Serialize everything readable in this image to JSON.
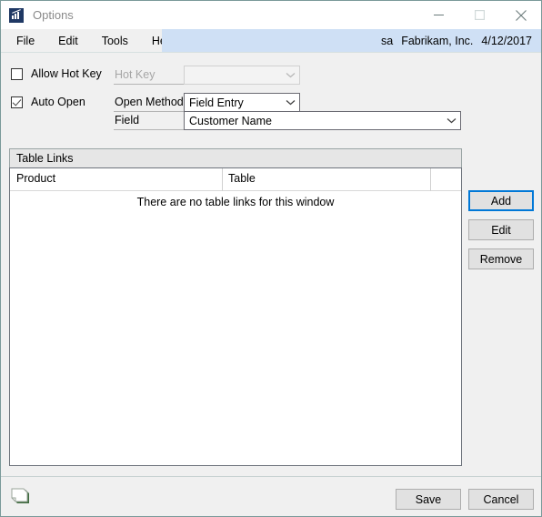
{
  "window": {
    "title": "Options",
    "app_icon": "chart-arrow-icon",
    "controls": {
      "minimize": "minimize-icon",
      "maximize": "maximize-icon",
      "close": "close-icon"
    }
  },
  "menubar": {
    "items": [
      {
        "label": "File"
      },
      {
        "label": "Edit"
      },
      {
        "label": "Tools"
      },
      {
        "label": "Help"
      }
    ],
    "status": {
      "user": "sa",
      "company": "Fabrikam, Inc.",
      "date": "4/12/2017",
      "background": "#cfe0f5"
    }
  },
  "form": {
    "allow_hot_key": {
      "label": "Allow Hot Key",
      "checked": false
    },
    "hot_key": {
      "label": "Hot Key",
      "value": "",
      "enabled": false
    },
    "auto_open": {
      "label": "Auto Open",
      "checked": true
    },
    "open_method": {
      "label": "Open Method",
      "value": "Field Entry",
      "enabled": true
    },
    "field": {
      "label": "Field",
      "value": "Customer Name",
      "enabled": true
    }
  },
  "table_links": {
    "panel_title": "Table Links",
    "columns": [
      "Product",
      "Table"
    ],
    "rows": [],
    "empty_message": "There are no table links for this window"
  },
  "side_buttons": [
    {
      "label": "Add",
      "focused": true
    },
    {
      "label": "Edit",
      "focused": false
    },
    {
      "label": "Remove",
      "focused": false
    }
  ],
  "bottom": {
    "note_icon": "note-icon",
    "save_label": "Save",
    "cancel_label": "Cancel"
  },
  "colors": {
    "window_background": "#f0f0f0",
    "list_background": "#ffffff",
    "panel_header": "#e6e6e6",
    "focus_accent": "#0078d7",
    "status_strip": "#cfe0f5",
    "title_text": "#8a8a8a",
    "window_border": "#7a9a9a"
  }
}
